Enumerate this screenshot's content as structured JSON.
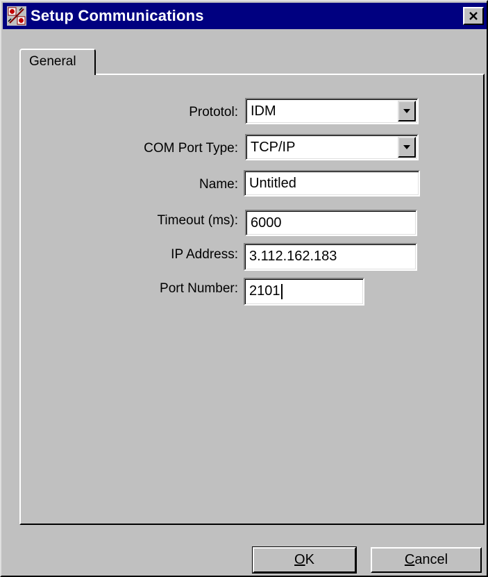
{
  "window": {
    "title": "Setup Communications",
    "close_glyph": "×",
    "titlebar_color": "#000080"
  },
  "tabs": [
    {
      "label": "General"
    }
  ],
  "form": {
    "protocol": {
      "label": "Prototol:",
      "value": "IDM"
    },
    "com_port_type": {
      "label": "COM Port Type:",
      "value": "TCP/IP"
    },
    "name": {
      "label": "Name:",
      "value": "Untitled"
    },
    "timeout": {
      "label": "Timeout (ms):",
      "value": "6000"
    },
    "ip_address": {
      "label": "IP Address:",
      "value": "3.112.162.183"
    },
    "port_number": {
      "label": "Port Number:",
      "value": "2101"
    }
  },
  "buttons": {
    "ok": {
      "mnemonic": "O",
      "rest": "K"
    },
    "cancel": {
      "mnemonic": "C",
      "rest": "ancel"
    }
  },
  "icons": {
    "app": "app-icon",
    "close": "close-icon",
    "dropdown": "chevron-down-icon"
  }
}
